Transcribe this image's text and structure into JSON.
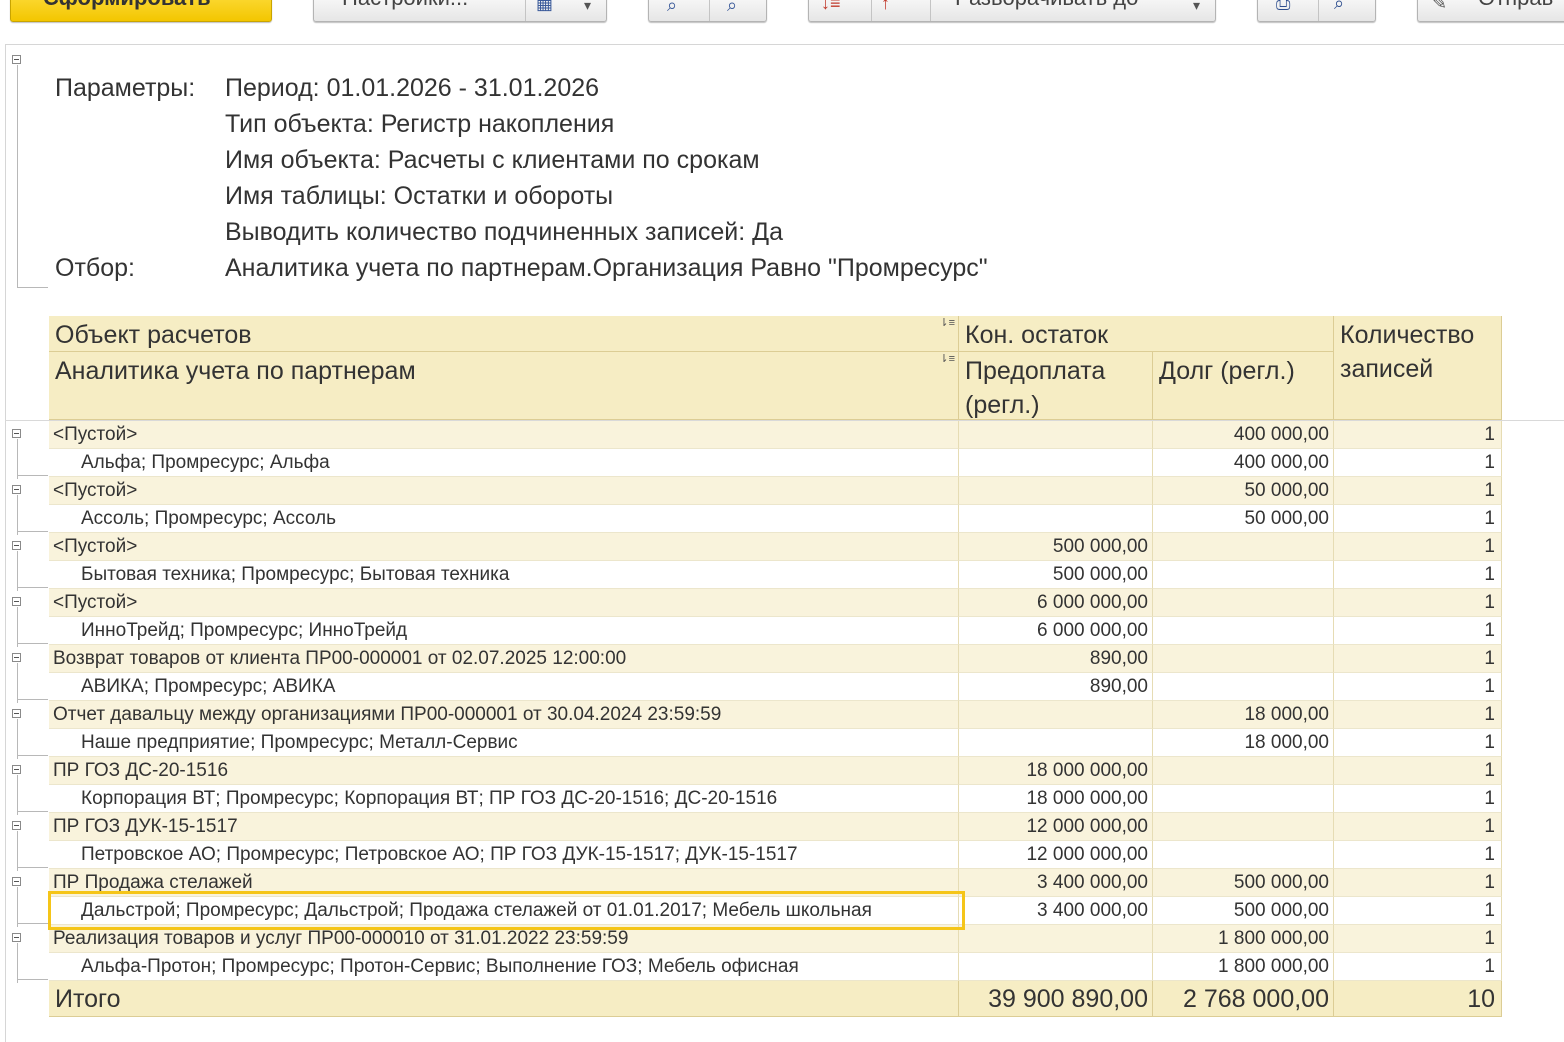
{
  "toolbar": {
    "generate_label": "Сформировать",
    "settings_label": "Настройки...",
    "expand_label": "Разворачивать до",
    "send_label": "Отправ"
  },
  "params": {
    "params_label": "Параметры:",
    "filter_label": "Отбор:",
    "lines": [
      "Период: 01.01.2026 - 31.01.2026",
      "Тип объекта: Регистр накопления",
      "Имя объекта: Расчеты с клиентами по срокам",
      "Имя таблицы: Остатки и обороты",
      "Выводить количество подчиненных записей: Да"
    ],
    "filter_value": "Аналитика учета по партнерам.Организация Равно \"Промресурс\""
  },
  "table": {
    "headers": {
      "object": "Объект расчетов",
      "analytics": "Аналитика учета по партнерам",
      "balance": "Кон. остаток",
      "prepay": "Предоплата (регл.)",
      "debt": "Долг (регл.)",
      "count": "Количество записей"
    },
    "rows": [
      {
        "type": "grp",
        "name": "<Пустой>",
        "prepay": "",
        "debt": "400 000,00",
        "count": "1"
      },
      {
        "type": "det",
        "name": "Альфа; Промресурс; Альфа",
        "prepay": "",
        "debt": "400 000,00",
        "count": "1"
      },
      {
        "type": "grp",
        "name": "<Пустой>",
        "prepay": "",
        "debt": "50 000,00",
        "count": "1"
      },
      {
        "type": "det",
        "name": "Ассоль; Промресурс; Ассоль",
        "prepay": "",
        "debt": "50 000,00",
        "count": "1"
      },
      {
        "type": "grp",
        "name": "<Пустой>",
        "prepay": "500 000,00",
        "debt": "",
        "count": "1"
      },
      {
        "type": "det",
        "name": "Бытовая техника; Промресурс; Бытовая техника",
        "prepay": "500 000,00",
        "debt": "",
        "count": "1"
      },
      {
        "type": "grp",
        "name": "<Пустой>",
        "prepay": "6 000 000,00",
        "debt": "",
        "count": "1"
      },
      {
        "type": "det",
        "name": "ИнноТрейд; Промресурс; ИнноТрейд",
        "prepay": "6 000 000,00",
        "debt": "",
        "count": "1"
      },
      {
        "type": "grp",
        "name": "Возврат товаров от клиента ПР00-000001 от 02.07.2025 12:00:00",
        "prepay": "890,00",
        "debt": "",
        "count": "1"
      },
      {
        "type": "det",
        "name": "АВИКА; Промресурс; АВИКА",
        "prepay": "890,00",
        "debt": "",
        "count": "1"
      },
      {
        "type": "grp",
        "name": "Отчет давальцу между организациями ПР00-000001 от 30.04.2024 23:59:59",
        "prepay": "",
        "debt": "18 000,00",
        "count": "1"
      },
      {
        "type": "det",
        "name": "Наше предприятие; Промресурс; Металл-Сервис",
        "prepay": "",
        "debt": "18 000,00",
        "count": "1"
      },
      {
        "type": "grp",
        "name": "ПР ГОЗ ДС-20-1516",
        "prepay": "18 000 000,00",
        "debt": "",
        "count": "1"
      },
      {
        "type": "det",
        "name": "Корпорация ВТ; Промресурс; Корпорация ВТ; ПР ГОЗ ДС-20-1516; ДС-20-1516",
        "prepay": "18 000 000,00",
        "debt": "",
        "count": "1"
      },
      {
        "type": "grp",
        "name": "ПР ГОЗ ДУК-15-1517",
        "prepay": "12 000 000,00",
        "debt": "",
        "count": "1"
      },
      {
        "type": "det",
        "name": "Петровское АО; Промресурс; Петровское АО; ПР ГОЗ ДУК-15-1517; ДУК-15-1517",
        "prepay": "12 000 000,00",
        "debt": "",
        "count": "1"
      },
      {
        "type": "grp",
        "name": "ПР Продажа стелажей",
        "prepay": "3 400 000,00",
        "debt": "500 000,00",
        "count": "1"
      },
      {
        "type": "det",
        "name": "Дальстрой; Промресурс; Дальстрой; Продажа стелажей от 01.01.2017; Мебель школьная",
        "prepay": "3 400 000,00",
        "debt": "500 000,00",
        "count": "1"
      },
      {
        "type": "grp",
        "name": "Реализация товаров и услуг ПР00-000010 от 31.01.2022 23:59:59",
        "prepay": "",
        "debt": "1 800 000,00",
        "count": "1"
      },
      {
        "type": "det",
        "name": "Альфа-Протон; Промресурс; Протон-Сервис; Выполнение ГОЗ; Мебель офисная",
        "prepay": "",
        "debt": "1 800 000,00",
        "count": "1"
      }
    ],
    "total": {
      "label": "Итого",
      "prepay": "39 900 890,00",
      "debt": "2 768 000,00",
      "count": "10"
    }
  }
}
